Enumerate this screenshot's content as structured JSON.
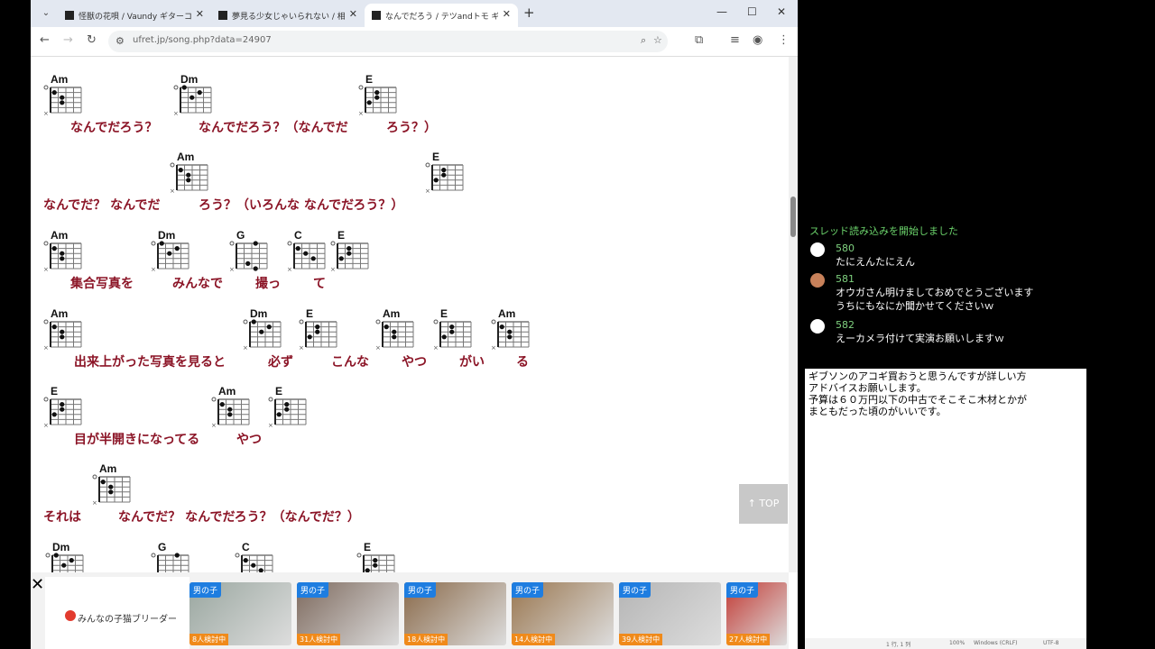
{
  "browser": {
    "tabs": [
      {
        "title": "怪獣の花唄 / Vaundy ギターコード/ウクレレ"
      },
      {
        "title": "夢見る少女じゃいられない / 相川七瀬"
      },
      {
        "title": "なんでだろう / テツandトモ ギターコード"
      }
    ],
    "url": "ufret.jp/song.php?data=24907",
    "new_tab": "+",
    "controls": {
      "minimize": "—",
      "maximize": "☐",
      "close": "✕"
    }
  },
  "song": {
    "lines": [
      {
        "chords": [
          {
            "name": "Am"
          },
          {
            "name": "Dm"
          },
          {
            "name": "E"
          }
        ],
        "lyrics": [
          "なんでだろう？",
          "なんでだろう？（なんでだ",
          "ろう？）"
        ]
      },
      {
        "chords": [
          {
            "name": "Am"
          },
          {
            "name": "E"
          }
        ],
        "lyrics": [
          "なんでだ？ なんでだ",
          "ろう？（いろんな なんでだろう？）"
        ]
      },
      {
        "chords": [
          {
            "name": "Am"
          },
          {
            "name": "Dm"
          },
          {
            "name": "G"
          },
          {
            "name": "C"
          },
          {
            "name": "E"
          }
        ],
        "lyrics": [
          "集合写真を",
          "みんなで",
          "撮っ",
          "て"
        ]
      },
      {
        "chords": [
          {
            "name": "Am"
          },
          {
            "name": "Dm"
          },
          {
            "name": "E"
          },
          {
            "name": "Am"
          },
          {
            "name": "E"
          },
          {
            "name": "Am"
          }
        ],
        "lyrics": [
          "出来上がった写真を見ると",
          "必ず",
          "こんな",
          "やつ",
          "がい",
          "る"
        ]
      },
      {
        "chords": [
          {
            "name": "E"
          },
          {
            "name": "Am"
          },
          {
            "name": "E"
          }
        ],
        "lyrics": [
          "目が半開きになってる",
          "やつ"
        ]
      },
      {
        "chords": [
          {
            "name": "Am"
          }
        ],
        "lyrics": [
          "それは",
          "なんでだ？ なんでだろう？（なんでだ？）"
        ]
      },
      {
        "chords": [
          {
            "name": "Dm"
          },
          {
            "name": "G"
          },
          {
            "name": "C"
          },
          {
            "name": "E"
          }
        ],
        "lyrics": []
      }
    ],
    "top_button": "↑ TOP"
  },
  "ad": {
    "brand": "みんなの子猫ブリーダー",
    "kittens": [
      {
        "badge": "男の子",
        "count": "8人検討中",
        "color": "#9aa7a0"
      },
      {
        "badge": "男の子",
        "count": "31人検討中",
        "color": "#7e6a5e"
      },
      {
        "badge": "男の子",
        "count": "18人検討中",
        "color": "#8a6a4a"
      },
      {
        "badge": "男の子",
        "count": "14人検討中",
        "color": "#9a7750"
      },
      {
        "badge": "男の子",
        "count": "39人検討中",
        "color": "#b5b5b5"
      },
      {
        "badge": "男の子",
        "count": "27人検討中",
        "color": "#c23b35"
      }
    ]
  },
  "chat": {
    "system": "スレッド読み込みを開始しました",
    "messages": [
      {
        "no": "580",
        "text": "たにえんたにえん"
      },
      {
        "no": "581",
        "text": "オウガさん明けましておめでとうございます\nうちにもなにか聞かせてくださいｗ"
      },
      {
        "no": "582",
        "text": "えーカメラ付けて実演お願いしますｗ"
      }
    ]
  },
  "notepad": {
    "text": "ギブソンのアコギ買おうと思うんですが詳しい方\nアドバイスお願いします。\n予算は６０万円以下の中古でそこそこ木材とかが\nまともだった頃のがいいです。",
    "status": [
      "1 行, 1 列",
      "100%",
      "Windows (CRLF)",
      "UTF-8"
    ]
  }
}
